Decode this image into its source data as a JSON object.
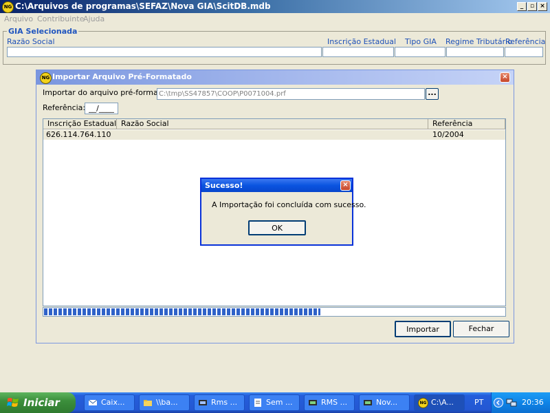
{
  "window": {
    "icon_text": "NG",
    "title": "C:\\Arquivos de programas\\SEFAZ\\Nova GIA\\ScitDB.mdb",
    "minimize": "_",
    "restore": "▫",
    "close": "×"
  },
  "menu": [
    "Arquivo",
    "Contribuinte",
    "Ajuda"
  ],
  "gia": {
    "title": "GIA Selecionada",
    "labels": {
      "razao_social": "Razão Social",
      "inscricao": "Inscrição Estadual",
      "tipo": "Tipo GIA",
      "regime": "Regime Tributário",
      "referencia": "Referência"
    }
  },
  "import_dialog": {
    "icon_text": "NG",
    "title": "Importar Arquivo Pré-Formatado",
    "close": "×",
    "file_label": "Importar do arquivo pré-formatado:",
    "file_path": "C:\\tmp\\SS47857\\COOP\\P0071004.prf",
    "browse": "...",
    "ref_label": "Referência:",
    "ref_value": "__/____",
    "columns": [
      "Inscrição Estadual",
      "Razão Social",
      "Referência"
    ],
    "rows": [
      {
        "inscricao": "626.114.764.110",
        "razao": "",
        "referencia": "10/2004"
      }
    ],
    "progress_fraction": 0.6,
    "import_button": "Importar",
    "close_button": "Fechar"
  },
  "message_box": {
    "title": "Sucesso!",
    "close": "×",
    "message": "A Importação foi concluída com sucesso.",
    "ok": "OK"
  },
  "taskbar": {
    "start": "Iniciar",
    "tasks": [
      "Caix...",
      "\\\\ba...",
      "Rms ...",
      "Sem ...",
      "RMS ...",
      "Nov...",
      "C:\\A..."
    ],
    "language": "PT",
    "clock": "20:36"
  },
  "colors": {
    "accent_blue": "#0a246a",
    "label_blue": "#1c4fb8",
    "progress": "#2f62c8"
  }
}
